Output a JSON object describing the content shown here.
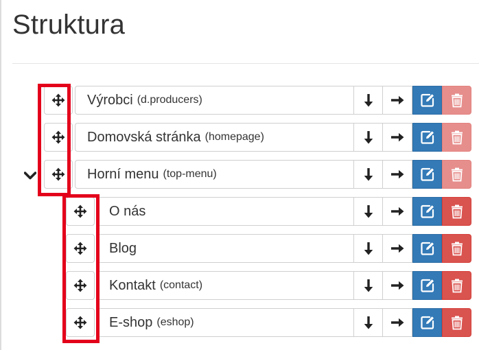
{
  "page": {
    "title": "Struktura"
  },
  "items": [
    {
      "name": "Výrobci",
      "code": "(d.producers)",
      "level": 0,
      "delete_disabled": true
    },
    {
      "name": "Domovská stránka",
      "code": "(homepage)",
      "level": 0,
      "delete_disabled": true
    },
    {
      "name": "Horní menu",
      "code": "(top-menu)",
      "level": 0,
      "delete_disabled": true,
      "expanded": true
    },
    {
      "name": "O nás",
      "code": "",
      "level": 1,
      "delete_disabled": false
    },
    {
      "name": "Blog",
      "code": "",
      "level": 1,
      "delete_disabled": false
    },
    {
      "name": "Kontakt",
      "code": "(contact)",
      "level": 1,
      "delete_disabled": false
    },
    {
      "name": "E-shop",
      "code": "(eshop)",
      "level": 1,
      "delete_disabled": false
    }
  ],
  "icons": {
    "handle": "move-arrows-icon",
    "down": "arrow-down-icon",
    "indent": "arrow-right-icon",
    "edit": "edit-icon",
    "delete": "trash-icon",
    "expanded": "chevron-down-icon"
  },
  "colors": {
    "primary": "#337ab7",
    "danger": "#d9534f",
    "highlight": "#e3001b",
    "text": "#333333"
  }
}
